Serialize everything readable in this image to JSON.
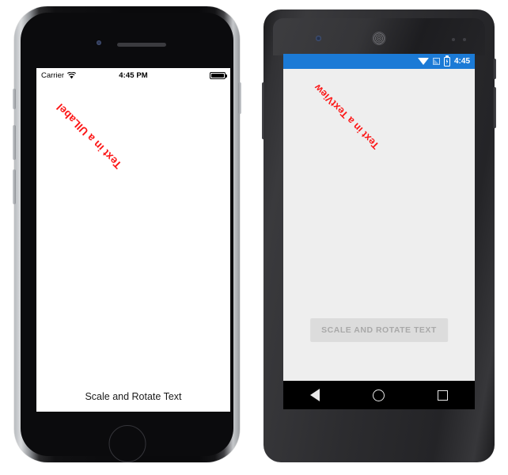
{
  "colors": {
    "android_accent": "#1b7ad6",
    "text_red": "#fc1616",
    "android_background": "#eeeeee",
    "ios_background": "#ffffff"
  },
  "ios": {
    "device_name": "iPhone",
    "status_bar": {
      "carrier": "Carrier",
      "wifi_icon": "wifi-icon",
      "time": "4:45 PM",
      "battery_icon": "battery-full-icon"
    },
    "rotated_text": "Text in a UILabel",
    "rotation_degrees": 225,
    "bottom_label": "Scale and Rotate Text",
    "hardware": {
      "camera": "front-camera",
      "speaker": "earpiece-speaker",
      "home_button": "home-button",
      "mute_switch": "mute-switch",
      "volume_up": "volume-up-button",
      "volume_down": "volume-down-button",
      "power": "power-button"
    }
  },
  "android": {
    "device_name": "Nexus",
    "status_bar": {
      "wifi_icon": "wifi-icon",
      "signal_icon": "signal-icon",
      "battery_icon": "battery-charging-icon",
      "time": "4:45"
    },
    "rotated_text": "Text in a TextView",
    "rotation_degrees": 225,
    "button_label": "SCALE AND ROTATE TEXT",
    "nav_bar": {
      "back": "back-icon",
      "home": "home-icon",
      "recents": "recents-icon"
    },
    "hardware": {
      "camera": "front-camera",
      "speaker": "earpiece-speaker",
      "sensor": "proximity-sensor",
      "power": "power-button",
      "volume": "volume-rocker"
    }
  }
}
